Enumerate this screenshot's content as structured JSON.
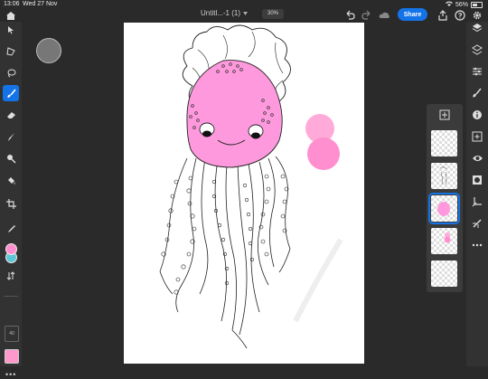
{
  "status_bar": {
    "time": "13:06",
    "date": "Wed 27 Nov",
    "battery": "56%"
  },
  "top_bar": {
    "document_title": "Untitl...-1 (1)",
    "zoom": "30%",
    "share_label": "Share"
  },
  "left_toolbar": {
    "tools": [
      "select-arrow",
      "transform",
      "lasso",
      "brush",
      "eraser",
      "smudge",
      "dodge",
      "fill",
      "crop",
      "eyedropper"
    ],
    "active_tool": "brush",
    "brush_size": "40",
    "primary_color": "#ff8fcf",
    "secondary_color": "#5fc6d6",
    "swatch_color": "#ff99cc"
  },
  "right_toolbar": {
    "tools": [
      "layers",
      "layer-properties",
      "adjustments",
      "info",
      "add-layer",
      "visibility",
      "mask",
      "clipping",
      "brush-settings",
      "more"
    ]
  },
  "layers": {
    "count": 5,
    "selected_index": 2
  },
  "colors": {
    "accent": "#1473e6",
    "pink_fill": "#ff99dd",
    "pink_blob": "#ff8fcf"
  }
}
